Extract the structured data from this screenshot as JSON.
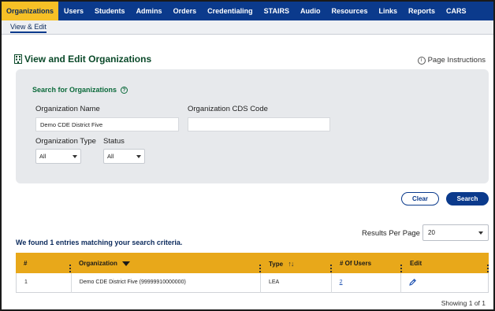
{
  "nav": {
    "items": [
      "Organizations",
      "Users",
      "Students",
      "Admins",
      "Orders",
      "Credentialing",
      "STAIRS",
      "Audio",
      "Resources",
      "Links",
      "Reports",
      "CARS"
    ],
    "active": "Organizations"
  },
  "subnav": {
    "label": "View & Edit"
  },
  "page": {
    "title": "View and Edit Organizations",
    "instructions": "Page Instructions"
  },
  "search": {
    "title": "Search for Organizations",
    "org_name_label": "Organization Name",
    "org_name_value": "Demo CDE District Five",
    "cds_label": "Organization CDS Code",
    "cds_value": "",
    "type_label": "Organization Type",
    "type_value": "All",
    "status_label": "Status",
    "status_value": "All",
    "clear": "Clear",
    "search": "Search"
  },
  "results": {
    "per_page_label": "Results Per Page",
    "per_page_value": "20",
    "found": "We found 1 entries matching your search criteria.",
    "columns": [
      "#",
      "Organization",
      "Type",
      "# Of Users",
      "Edit"
    ],
    "rows": [
      {
        "num": "1",
        "organization": "Demo CDE District Five (99999910000000)",
        "type": "LEA",
        "users": "2"
      }
    ],
    "showing": "Showing 1 of 1"
  },
  "colors": {
    "nav": "#0b3a8c",
    "active": "#f6c026",
    "header": "#e8a81a",
    "title": "#0b4a2a"
  }
}
